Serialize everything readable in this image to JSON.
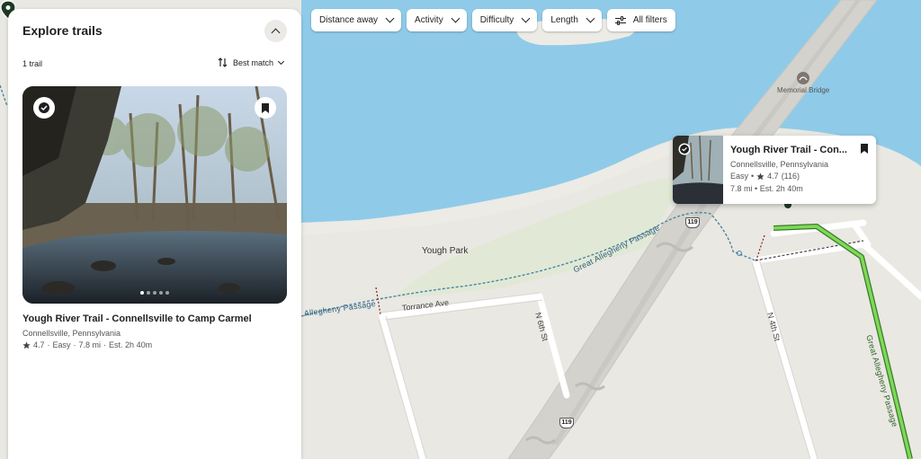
{
  "colors": {
    "water": "#8fcbe9",
    "land": "#e9e8e2",
    "park": "#e1e9d6",
    "accent_green": "#7ed957",
    "marker_dark": "#1d3a24",
    "trail_dashed": "#4a86a3"
  },
  "panel": {
    "title": "Explore trails",
    "collapse_icon": "chevron-up-icon",
    "count": "1 trail",
    "sort_label": "Best match",
    "sort_icon": "sort-arrows-icon"
  },
  "card": {
    "title": "Yough River Trail - Connellsville to Camp Carmel",
    "location": "Connellsville, Pennsylvania",
    "rating": "4.7",
    "difficulty": "Easy",
    "length": "7.8 mi",
    "duration": "Est. 2h 40m",
    "sep": "·",
    "verified_icon": "verified-badge-icon",
    "bookmark_icon": "bookmark-icon",
    "photo_count": 5,
    "photo_active_index": 0
  },
  "filters": [
    {
      "label": "Distance away"
    },
    {
      "label": "Activity"
    },
    {
      "label": "Difficulty"
    },
    {
      "label": "Length"
    },
    {
      "label": "All filters"
    }
  ],
  "popup": {
    "title": "Yough River Trail - Con...",
    "location": "Connellsville, Pennsylvania",
    "difficulty": "Easy",
    "rating": "4.7",
    "reviews": "(116)",
    "length": "7.8 mi",
    "duration": "Est. 2h 40m",
    "sep": "•"
  },
  "map": {
    "labels": {
      "memorial_bridge": "Memorial Bridge",
      "yough_park": "Yough Park",
      "torrance_ave": "Torrance Ave",
      "n6th": "N 6th St",
      "n4th": "N 4th St",
      "trail_gap_1": "Great Allegheny Passage",
      "trail_gap_2": "Allegheny Passage",
      "trail_gap_3": "Great Allegheny Passage",
      "route_119_a": "119",
      "route_119_b": "119"
    }
  }
}
